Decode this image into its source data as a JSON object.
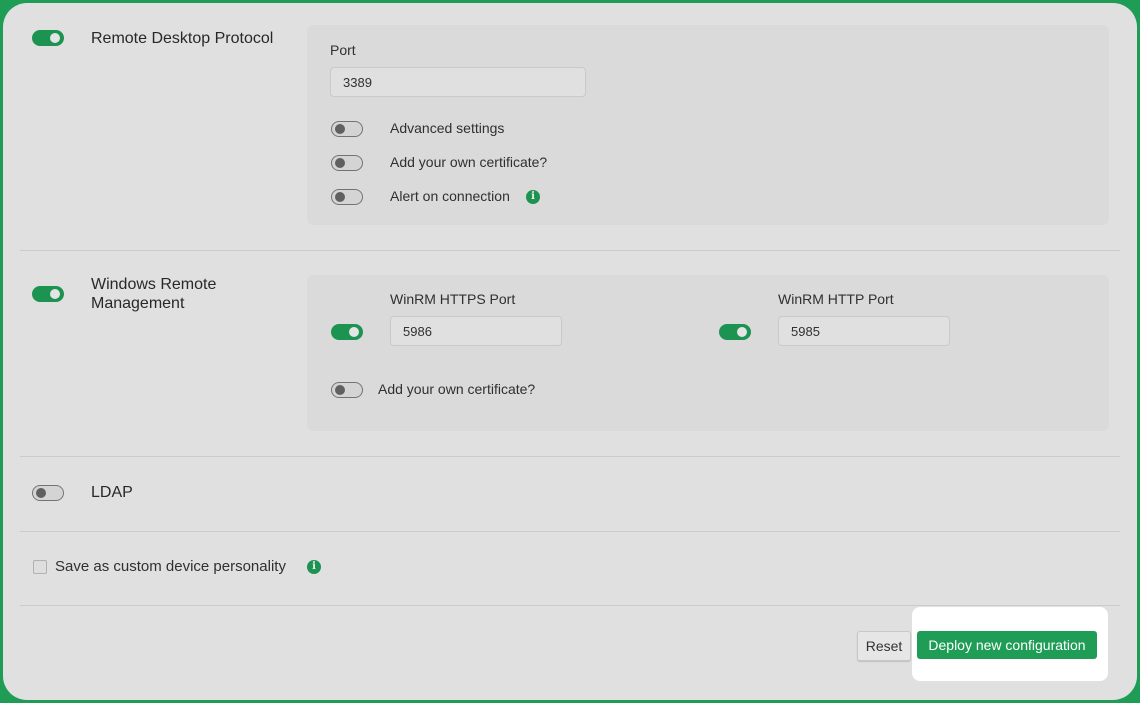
{
  "rdp": {
    "title": "Remote Desktop Protocol",
    "enabled": true,
    "port_label": "Port",
    "port_value": "3389",
    "options": [
      {
        "label": "Advanced settings",
        "enabled": false
      },
      {
        "label": "Add your own certificate?",
        "enabled": false
      },
      {
        "label": "Alert on connection",
        "enabled": false
      }
    ]
  },
  "winrm": {
    "title": "Windows Remote Management",
    "enabled": true,
    "https_label": "WinRM HTTPS Port",
    "https_value": "5986",
    "https_enabled": true,
    "http_label": "WinRM HTTP Port",
    "http_value": "5985",
    "http_enabled": true,
    "cert_label": "Add your own certificate?",
    "cert_enabled": false
  },
  "ldap": {
    "title": "LDAP",
    "enabled": false
  },
  "save_personality": {
    "label": "Save as custom device personality",
    "checked": false
  },
  "actions": {
    "reset_label": "Reset",
    "deploy_label": "Deploy new configuration"
  },
  "colors": {
    "accent": "#1f9d57",
    "background": "#eeeeee"
  },
  "icons": {
    "info": "info-icon"
  }
}
